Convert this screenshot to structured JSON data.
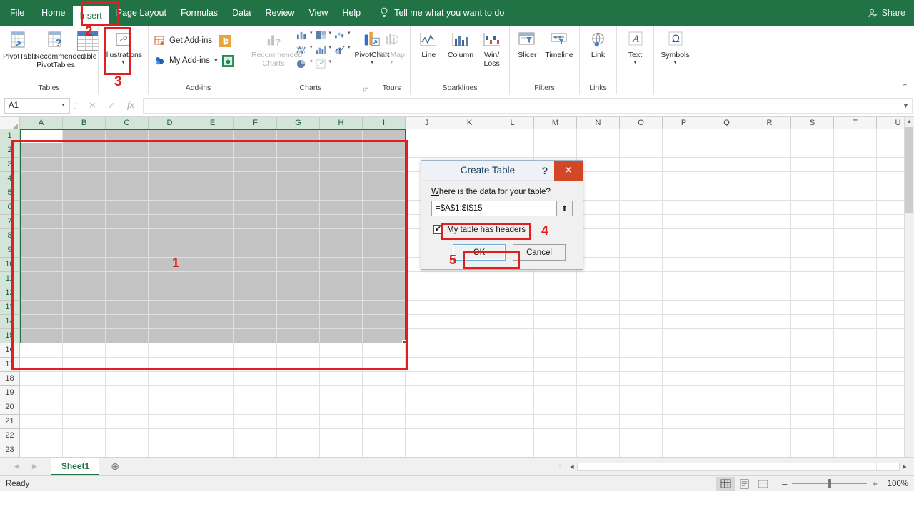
{
  "ribbon_tabs": [
    {
      "label": "File",
      "active": false
    },
    {
      "label": "Home",
      "active": false
    },
    {
      "label": "Insert",
      "active": true
    },
    {
      "label": "Page Layout",
      "active": false
    },
    {
      "label": "Formulas",
      "active": false
    },
    {
      "label": "Data",
      "active": false
    },
    {
      "label": "Review",
      "active": false
    },
    {
      "label": "View",
      "active": false
    },
    {
      "label": "Help",
      "active": false
    }
  ],
  "tellme": {
    "placeholder": "Tell me what you want to do",
    "icon": "lightbulb-icon"
  },
  "share": {
    "label": "Share",
    "icon": "share-person-icon"
  },
  "ribbon_groups": [
    {
      "name": "Tables",
      "label": "Tables",
      "buttons": [
        {
          "label": "PivotTable",
          "icon": "pivottable-icon",
          "disabled": false,
          "caret": false
        },
        {
          "label": "Recommended PivotTables",
          "icon": "recommended-pivottables-icon",
          "disabled": false,
          "caret": false
        },
        {
          "label": "Table",
          "icon": "table-icon",
          "disabled": false,
          "caret": false
        }
      ]
    },
    {
      "name": "Illustrations",
      "label": "",
      "buttons": [
        {
          "label": "Illustrations",
          "icon": "illustrations-icon",
          "disabled": false,
          "caret": true
        }
      ]
    },
    {
      "name": "Add-ins",
      "label": "Add-ins",
      "buttons": [
        {
          "label": "Get Add-ins",
          "icon": "get-addins-icon"
        },
        {
          "label": "My Add-ins",
          "icon": "my-addins-icon"
        }
      ],
      "extra_icons": [
        "bing-addin-icon",
        "office-addin-icon"
      ]
    },
    {
      "name": "Charts",
      "label": "Charts",
      "buttons": [
        {
          "label": "Recommended Charts",
          "icon": "recommended-charts-icon",
          "disabled": true
        },
        {
          "label": "PivotChart",
          "icon": "pivotchart-icon",
          "disabled": false,
          "caret": true
        }
      ],
      "chart_type_icons": [
        "column-chart-icon",
        "hierarchy-chart-icon",
        "waterfall-chart-icon",
        "statistic-chart-icon",
        "bar-chart-icon",
        "combo-chart-icon",
        "pie-chart-icon",
        "scatter-chart-icon"
      ],
      "has_dialog_launcher": true
    },
    {
      "name": "Tours",
      "label": "Tours",
      "buttons": [
        {
          "label": "3D Map",
          "icon": "3d-map-icon",
          "disabled": true,
          "caret": true
        }
      ]
    },
    {
      "name": "Sparklines",
      "label": "Sparklines",
      "buttons": [
        {
          "label": "Line",
          "icon": "sparkline-line-icon"
        },
        {
          "label": "Column",
          "icon": "sparkline-column-icon"
        },
        {
          "label": "Win/ Loss",
          "icon": "sparkline-winloss-icon"
        }
      ]
    },
    {
      "name": "Filters",
      "label": "Filters",
      "buttons": [
        {
          "label": "Slicer",
          "icon": "slicer-icon"
        },
        {
          "label": "Timeline",
          "icon": "timeline-icon"
        }
      ]
    },
    {
      "name": "Links",
      "label": "Links",
      "buttons": [
        {
          "label": "Link",
          "icon": "link-icon"
        }
      ]
    },
    {
      "name": "Text",
      "label": "",
      "buttons": [
        {
          "label": "Text",
          "icon": "text-icon",
          "caret": true
        }
      ]
    },
    {
      "name": "Symbols",
      "label": "",
      "buttons": [
        {
          "label": "Symbols",
          "icon": "omega-symbols-icon",
          "caret": true
        }
      ]
    }
  ],
  "collapse_ribbon": {
    "icon": "chevron-up-icon"
  },
  "formula_bar": {
    "name_box_value": "A1",
    "cancel_icon": "cancel-x-icon",
    "enter_icon": "enter-check-icon",
    "function_icon": "insert-function-fx-icon",
    "formula_value": "",
    "expand_icon": "chevron-down-icon"
  },
  "grid": {
    "columns": [
      "A",
      "B",
      "C",
      "D",
      "E",
      "F",
      "G",
      "H",
      "I",
      "J",
      "K",
      "L",
      "M",
      "N",
      "O",
      "P",
      "Q",
      "R",
      "S",
      "T",
      "U"
    ],
    "rows": [
      1,
      2,
      3,
      4,
      5,
      6,
      7,
      8,
      9,
      10,
      11,
      12,
      13,
      14,
      15,
      16,
      17,
      18,
      19,
      20,
      21,
      22,
      23
    ],
    "selected_columns": [
      "A",
      "B",
      "C",
      "D",
      "E",
      "F",
      "G",
      "H",
      "I"
    ],
    "selected_rows": [
      1,
      2,
      3,
      4,
      5,
      6,
      7,
      8,
      9,
      10,
      11,
      12,
      13,
      14,
      15
    ],
    "active_cell": "A1",
    "selection_range": "A1:I15"
  },
  "dialog": {
    "title": "Create Table",
    "help_label": "?",
    "close_label": "✕",
    "question": "Where is the data for your table?",
    "range_value": "=$A$1:$I$15",
    "collapse_icon": "collapse-dialog-icon",
    "checkbox": {
      "label": "My table has headers",
      "checked": true,
      "mark": "✔"
    },
    "ok_label": "OK",
    "cancel_label": "Cancel"
  },
  "sheet_tabs": {
    "prev_icon": "nav-prev-icon",
    "next_icon": "nav-next-icon",
    "tabs": [
      {
        "label": "Sheet1",
        "active": true
      }
    ],
    "add_label": "⊕"
  },
  "status_bar": {
    "status": "Ready",
    "views": [
      {
        "name": "normal-view",
        "icon": "normal-view-icon",
        "active": true
      },
      {
        "name": "page-layout-view",
        "icon": "page-layout-view-icon",
        "active": false
      },
      {
        "name": "page-break-view",
        "icon": "page-break-view-icon",
        "active": false
      }
    ],
    "zoom_out": "–",
    "zoom_in": "+",
    "zoom_level": "100%"
  },
  "annotations": [
    {
      "number": "1",
      "target": "selected-cell-range"
    },
    {
      "number": "2",
      "target": "insert-tab"
    },
    {
      "number": "3",
      "target": "table-button"
    },
    {
      "number": "4",
      "target": "my-table-has-headers-checkbox"
    },
    {
      "number": "5",
      "target": "ok-button"
    }
  ],
  "colors": {
    "brand_green": "#217346",
    "annotation_red": "#e02020",
    "dialog_close_red": "#d24726",
    "selection_gray": "#c3c3c3"
  }
}
